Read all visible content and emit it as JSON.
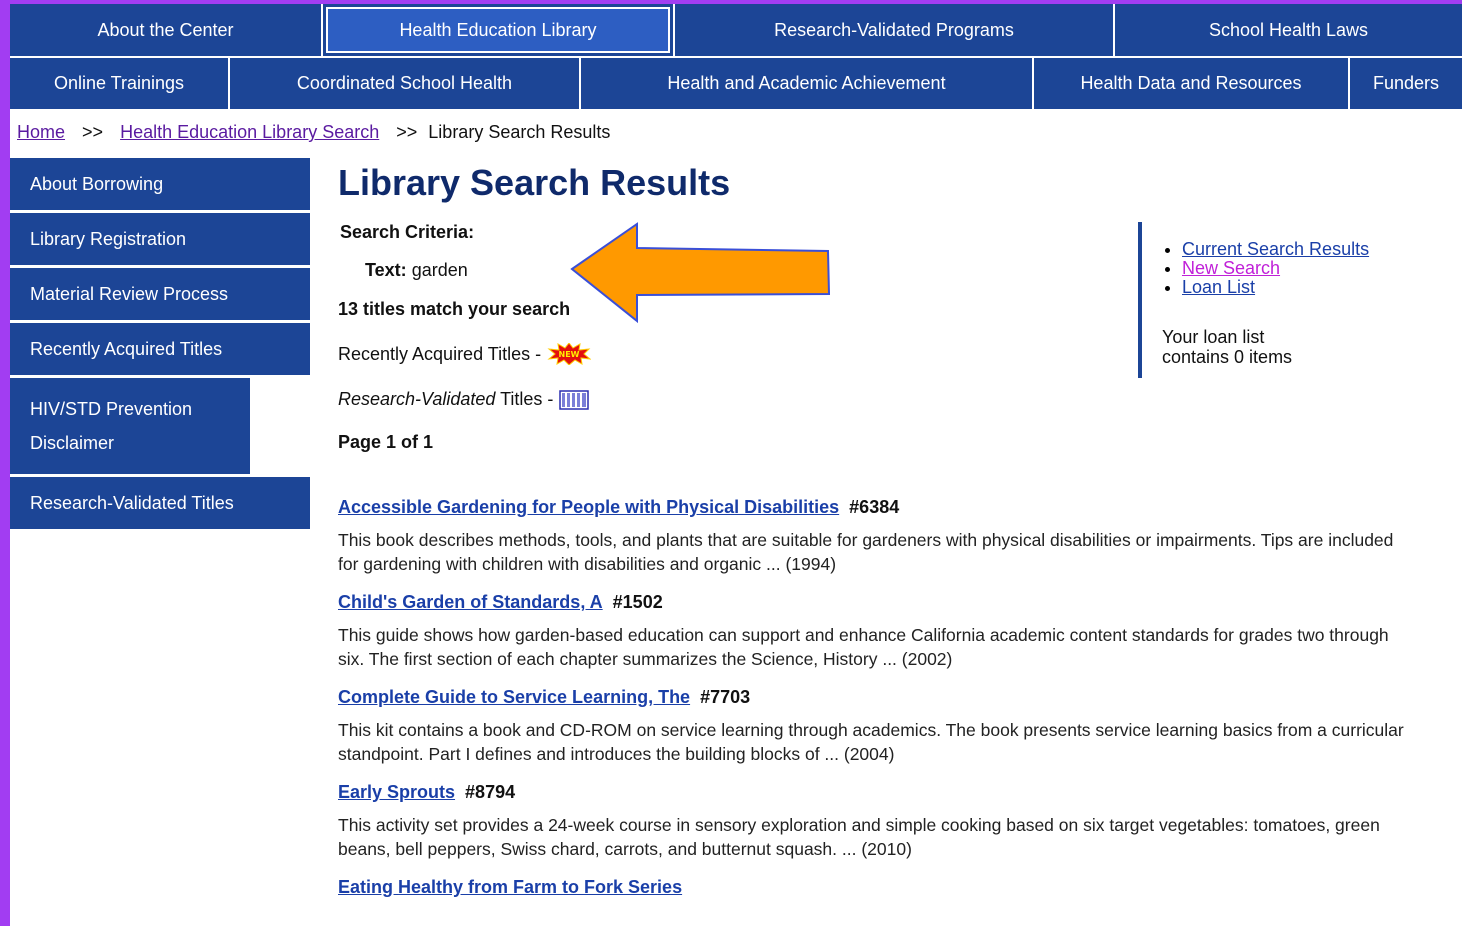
{
  "nav": {
    "row1": [
      "About the Center",
      "Health Education Library",
      "Research-Validated Programs",
      "School Health Laws"
    ],
    "row2": [
      "Online Trainings",
      "Coordinated School Health",
      "Health and Academic Achievement",
      "Health Data and Resources",
      "Funders"
    ]
  },
  "breadcrumb": {
    "home": "Home",
    "sep1": ">>",
    "search": "Health Education Library Search",
    "sep2": ">>",
    "current": "Library Search Results"
  },
  "sidebar": [
    "About Borrowing",
    "Library Registration",
    "Material Review Process",
    "Recently Acquired Titles",
    "HIV/STD Prevention Disclaimer",
    "Research-Validated Titles"
  ],
  "main": {
    "title": "Library Search Results",
    "criteria_label": "Search Criteria:",
    "text_label": "Text:",
    "text_value": "garden",
    "match_count": "13 titles match your search",
    "recent_label": "Recently Acquired Titles -",
    "new_badge": "NEW",
    "rv_label_italic": "Research-Validated",
    "rv_label_rest": " Titles -",
    "page_info": "Page 1 of 1"
  },
  "results": [
    {
      "title": "Accessible Gardening for People with Physical Disabilities",
      "number": "#6384",
      "desc": "This book describes methods, tools, and plants that are suitable for gardeners with physical disabilities or impairments. Tips are included for gardening with children with disabilities and organic ... (1994)"
    },
    {
      "title": "Child's Garden of Standards, A",
      "number": "#1502",
      "desc": "This guide shows how garden-based education can support and enhance California academic content standards for grades two through six. The first section of each chapter summarizes the Science, History ... (2002)"
    },
    {
      "title": "Complete Guide to Service Learning, The",
      "number": "#7703",
      "desc": "This kit contains a book and CD-ROM on service learning through academics. The book presents service learning basics from a curricular standpoint. Part I defines and introduces the building blocks of ... (2004)"
    },
    {
      "title": "Early Sprouts",
      "number": "#8794",
      "desc": "This activity set provides a 24-week course in sensory exploration and simple cooking based on six target vegetables: tomatoes, green beans, bell peppers, Swiss chard, carrots, and butternut squash. ... (2010)"
    },
    {
      "title": "Eating Healthy from Farm to Fork Series",
      "number": "",
      "desc": ""
    }
  ],
  "right_panel": {
    "links": [
      "Current Search Results",
      "New Search",
      "Loan List"
    ],
    "loan_line1": "Your loan list",
    "loan_line2": "contains 0 items"
  },
  "colors": {
    "nav_bg": "#1c4596",
    "frame_bg": "#a23df2",
    "arrow_fill": "#ff9900",
    "arrow_stroke": "#3a4fd8"
  }
}
